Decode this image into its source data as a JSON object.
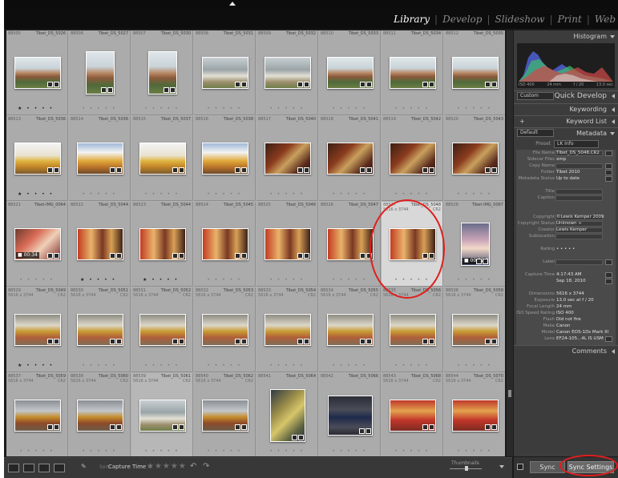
{
  "module_picker": {
    "items": [
      "Library",
      "Develop",
      "Slideshow",
      "Print",
      "Web"
    ],
    "active": "Library",
    "separator": "|"
  },
  "grid": {
    "cells": [
      {
        "num": "88505",
        "fn": "Tibet_DS_5026",
        "dim": "",
        "ext": "",
        "kind": "pal",
        "orient": "land",
        "stars": "rated",
        "dur": ""
      },
      {
        "num": "88506",
        "fn": "Tibet_DS_5027",
        "dim": "",
        "ext": "",
        "kind": "pal",
        "orient": "port",
        "stars": "dots",
        "dur": ""
      },
      {
        "num": "88507",
        "fn": "Tibet_DS_5030",
        "dim": "",
        "ext": "",
        "kind": "pal",
        "orient": "port",
        "stars": "dots",
        "dur": ""
      },
      {
        "num": "88508",
        "fn": "Tibet_DS_5031",
        "dim": "",
        "ext": "",
        "kind": "clouds",
        "orient": "land",
        "stars": "dots",
        "dur": ""
      },
      {
        "num": "88509",
        "fn": "Tibet_DS_5032",
        "dim": "",
        "ext": "",
        "kind": "clouds",
        "orient": "land",
        "stars": "dots",
        "dur": ""
      },
      {
        "num": "88510",
        "fn": "Tibet_DS_5033",
        "dim": "",
        "ext": "",
        "kind": "pal",
        "orient": "land",
        "stars": "dots",
        "dur": ""
      },
      {
        "num": "88511",
        "fn": "Tibet_DS_5034",
        "dim": "",
        "ext": "",
        "kind": "pal",
        "orient": "land",
        "stars": "dots",
        "dur": ""
      },
      {
        "num": "88512",
        "fn": "Tibet_DS_5035",
        "dim": "",
        "ext": "",
        "kind": "pal",
        "orient": "land",
        "stars": "dots",
        "dur": ""
      },
      {
        "num": "88513",
        "fn": "Tibet_DS_5036",
        "dim": "",
        "ext": "",
        "kind": "roof",
        "orient": "land",
        "stars": "rated",
        "dur": ""
      },
      {
        "num": "88514",
        "fn": "Tibet_DS_5036",
        "dim": "",
        "ext": "",
        "kind": "roofc",
        "orient": "land",
        "stars": "dots",
        "dur": ""
      },
      {
        "num": "88515",
        "fn": "Tibet_DS_5037",
        "dim": "",
        "ext": "",
        "kind": "roof",
        "orient": "land",
        "stars": "dots",
        "dur": ""
      },
      {
        "num": "88516",
        "fn": "Tibet_DS_5038",
        "dim": "",
        "ext": "",
        "kind": "roofc",
        "orient": "land",
        "stars": "dots",
        "dur": ""
      },
      {
        "num": "88517",
        "fn": "Tibet_DS_5040",
        "dim": "",
        "ext": "",
        "kind": "interior",
        "orient": "land",
        "stars": "dots",
        "dur": ""
      },
      {
        "num": "88518",
        "fn": "Tibet_DS_5041",
        "dim": "",
        "ext": "",
        "kind": "interior",
        "orient": "land",
        "stars": "dots",
        "dur": ""
      },
      {
        "num": "88519",
        "fn": "Tibet_DS_5042",
        "dim": "",
        "ext": "",
        "kind": "interior",
        "orient": "land",
        "stars": "dots",
        "dur": ""
      },
      {
        "num": "88520",
        "fn": "Tibet_DS_5043",
        "dim": "",
        "ext": "",
        "kind": "interior",
        "orient": "land",
        "stars": "dots",
        "dur": ""
      },
      {
        "num": "88521",
        "fn": "Tibet-IMG_0064",
        "dim": "",
        "ext": "",
        "kind": "people",
        "orient": "land",
        "stars": "dots",
        "dur": "00:34"
      },
      {
        "num": "88522",
        "fn": "Tibet_DS_5044",
        "dim": "",
        "ext": "",
        "kind": "room",
        "orient": "land",
        "stars": "rated",
        "dur": ""
      },
      {
        "num": "88523",
        "fn": "Tibet_DS_5044",
        "dim": "",
        "ext": "",
        "kind": "room",
        "orient": "land",
        "stars": "rated",
        "dur": ""
      },
      {
        "num": "88524",
        "fn": "Tibet_DS_5045",
        "dim": "",
        "ext": "",
        "kind": "room",
        "orient": "land",
        "stars": "dots",
        "dur": ""
      },
      {
        "num": "88525",
        "fn": "Tibet_DS_5046",
        "dim": "",
        "ext": "",
        "kind": "room",
        "orient": "land",
        "stars": "dots",
        "dur": ""
      },
      {
        "num": "88526",
        "fn": "Tibet_DS_5047",
        "dim": "",
        "ext": "",
        "kind": "room",
        "orient": "land",
        "stars": "dots",
        "dur": ""
      },
      {
        "num": "88527",
        "fn": "Tibet_DS_5048",
        "dim": "5616 x 3744",
        "ext": "CR2",
        "kind": "room",
        "orient": "land",
        "stars": "dots",
        "dur": "",
        "sel": true
      },
      {
        "num": "88528",
        "fn": "Tibet-IMG_0067",
        "dim": "",
        "ext": "",
        "kind": "portrait",
        "orient": "port",
        "stars": "dots",
        "dur": "00:22"
      },
      {
        "num": "88529",
        "fn": "Tibet_DS_5049",
        "dim": "5616 x 3744",
        "ext": "CR2",
        "kind": "stupa",
        "orient": "land",
        "stars": "rated",
        "dur": ""
      },
      {
        "num": "88530",
        "fn": "Tibet_DS_5051",
        "dim": "5616 x 3744",
        "ext": "CR2",
        "kind": "stupa",
        "orient": "land",
        "stars": "dots",
        "dur": ""
      },
      {
        "num": "88531",
        "fn": "Tibet_DS_5052",
        "dim": "5616 x 3744",
        "ext": "CR2",
        "kind": "stupa",
        "orient": "land",
        "stars": "dots",
        "dur": ""
      },
      {
        "num": "88532",
        "fn": "Tibet_DS_5053",
        "dim": "5616 x 3744",
        "ext": "CR2",
        "kind": "stupa",
        "orient": "land",
        "stars": "dots",
        "dur": ""
      },
      {
        "num": "88533",
        "fn": "Tibet_DS_5054",
        "dim": "5616 x 3744",
        "ext": "CR2",
        "kind": "stupa",
        "orient": "land",
        "stars": "dots",
        "dur": ""
      },
      {
        "num": "88534",
        "fn": "Tibet_DS_5055",
        "dim": "5616 x 3744",
        "ext": "CR2",
        "kind": "stupa",
        "orient": "land",
        "stars": "dots",
        "dur": ""
      },
      {
        "num": "88535",
        "fn": "Tibet_DS_5056",
        "dim": "5616 x 3744",
        "ext": "CR2",
        "kind": "stupa",
        "orient": "land",
        "stars": "dots",
        "dur": ""
      },
      {
        "num": "88536",
        "fn": "Tibet_DS_5058",
        "dim": "5616 x 3744",
        "ext": "CR2",
        "kind": "stupa",
        "orient": "land",
        "stars": "dots",
        "dur": ""
      },
      {
        "num": "88537",
        "fn": "Tibet_DS_5059",
        "dim": "5616 x 3744",
        "ext": "CR2",
        "kind": "stupa2",
        "orient": "land",
        "stars": "dots",
        "dur": ""
      },
      {
        "num": "88538",
        "fn": "Tibet_DS_5060",
        "dim": "5616 x 3744",
        "ext": "CR2",
        "kind": "stupa2",
        "orient": "land",
        "stars": "dots",
        "dur": ""
      },
      {
        "num": "88539",
        "fn": "Tibet_DS_5061",
        "dim": "5616 x 3744",
        "ext": "CR2",
        "kind": "clouds",
        "orient": "land",
        "stars": "dots",
        "dur": "",
        "marked": true
      },
      {
        "num": "88540",
        "fn": "Tibet_DS_5062",
        "dim": "5616 x 3744",
        "ext": "CR2",
        "kind": "stupa2",
        "orient": "land",
        "stars": "dots",
        "dur": ""
      },
      {
        "num": "88541",
        "fn": "Tibet_DS_5064",
        "dim": "",
        "ext": "",
        "kind": "mural",
        "orient": "port",
        "stars": "dots",
        "dur": ""
      },
      {
        "num": "88542",
        "fn": "Tibet_DS_5066",
        "dim": "",
        "ext": "",
        "kind": "sign",
        "orient": "land",
        "stars": "dots",
        "dur": ""
      },
      {
        "num": "88543",
        "fn": "Tibet_DS_5068",
        "dim": "5616 x 3744",
        "ext": "CR2",
        "kind": "crowd",
        "orient": "land",
        "stars": "dots",
        "dur": ""
      },
      {
        "num": "88544",
        "fn": "Tibet_DS_5070",
        "dim": "5616 x 3744",
        "ext": "CR2",
        "kind": "crowd",
        "orient": "land",
        "stars": "dots",
        "dur": ""
      }
    ],
    "star_dots": "• • • • •",
    "star_rated": "★ • • • •",
    "video_icon": "■"
  },
  "toolbar": {
    "sort_label": "Sort:",
    "sort_value": "Capture Time ÷",
    "rating_stars": "★★★★★",
    "thumbnails_label": "Thumbnails"
  },
  "right_panel": {
    "histogram_title": "Histogram",
    "histogram_info": {
      "iso": "ISO 400",
      "focal": "24 mm",
      "aperture": "f / 20",
      "shutter": "13.0 sec"
    },
    "quick_develop": {
      "title": "Quick Develop",
      "preset": "Custom"
    },
    "keywording": "Keywording",
    "keyword_list": "Keyword List",
    "metadata": {
      "title": "Metadata",
      "view": "Default",
      "preset_label": "Preset",
      "preset_value": "LK Info",
      "rows": [
        {
          "label": "File Name",
          "value": "Tibet_DS_5048.CR2",
          "field": true,
          "btn": true
        },
        {
          "label": "Sidecar Files",
          "value": "xmp",
          "field": false,
          "btn": false
        },
        {
          "label": "Copy Name",
          "value": "",
          "field": true,
          "btn": true
        },
        {
          "label": "Folder",
          "value": "Tibet 2010",
          "field": false,
          "btn": true
        },
        {
          "label": "Metadata Status",
          "value": "Up to date",
          "field": false,
          "btn": true
        },
        {
          "label": "",
          "value": "",
          "field": false,
          "btn": false
        },
        {
          "label": "Title",
          "value": "",
          "field": true,
          "btn": false
        },
        {
          "label": "Caption",
          "value": "",
          "field": true,
          "btn": false
        },
        {
          "label": "",
          "value": "",
          "field": false,
          "btn": false
        },
        {
          "label": "",
          "value": "",
          "field": false,
          "btn": false
        },
        {
          "label": "Copyright",
          "value": "©Lewis Kemper 2009",
          "field": true,
          "btn": false
        },
        {
          "label": "Copyright Status",
          "value": "Unknown ÷",
          "field": true,
          "btn": false
        },
        {
          "label": "Creator",
          "value": "Lewis Kemper",
          "field": true,
          "btn": false
        },
        {
          "label": "Sublocation",
          "value": "",
          "field": true,
          "btn": false
        },
        {
          "label": "",
          "value": "",
          "field": false,
          "btn": false
        },
        {
          "label": "Rating",
          "value": "• • • • •",
          "field": false,
          "btn": false
        },
        {
          "label": "",
          "value": "",
          "field": false,
          "btn": false
        },
        {
          "label": "Label",
          "value": "",
          "field": true,
          "btn": true
        },
        {
          "label": "",
          "value": "",
          "field": false,
          "btn": false
        },
        {
          "label": "Capture Time",
          "value": "4:17:43 AM",
          "field": false,
          "btn": true
        },
        {
          "label": "",
          "value": "Sep 18, 2010",
          "field": false,
          "btn": true
        },
        {
          "label": "",
          "value": "",
          "field": false,
          "btn": false
        },
        {
          "label": "Dimensions",
          "value": "5616 x 3744",
          "field": false,
          "btn": false
        },
        {
          "label": "Exposure",
          "value": "13.0 sec at f / 20",
          "field": false,
          "btn": false
        },
        {
          "label": "Focal Length",
          "value": "24 mm",
          "field": false,
          "btn": false
        },
        {
          "label": "ISO Speed Rating",
          "value": "ISO 400",
          "field": false,
          "btn": false
        },
        {
          "label": "Flash",
          "value": "Did not fire",
          "field": false,
          "btn": false
        },
        {
          "label": "Make",
          "value": "Canon",
          "field": false,
          "btn": false
        },
        {
          "label": "Model",
          "value": "Canon EOS-1Ds Mark III",
          "field": false,
          "btn": false
        },
        {
          "label": "Lens",
          "value": "EF24-105...4L IS USM",
          "field": false,
          "btn": true
        }
      ]
    },
    "comments": "Comments"
  },
  "sync": {
    "sync_label": "Sync",
    "sync_settings_label": "Sync Settings"
  },
  "colors": {
    "annotation_red": "#e01e1e",
    "panel_bg": "#3c3c3c",
    "grid_bg": "#b0b0b0"
  }
}
